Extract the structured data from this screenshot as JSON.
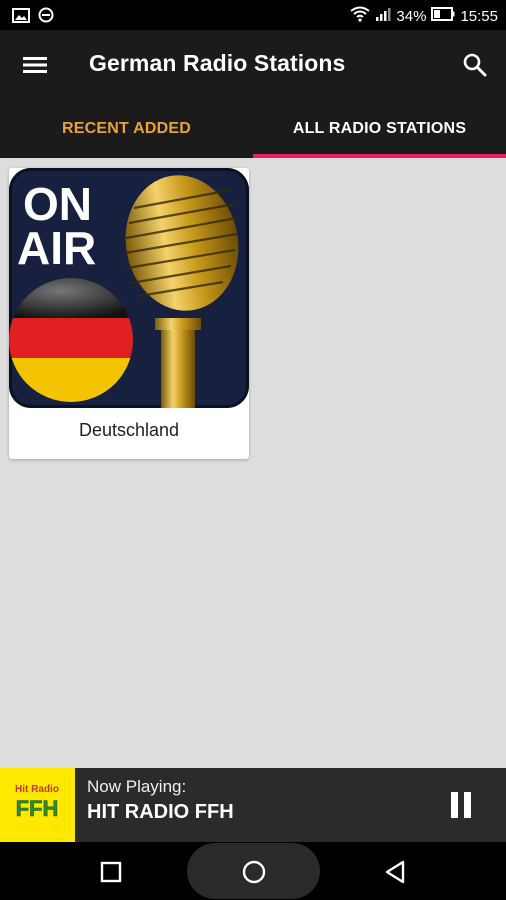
{
  "status_bar": {
    "battery": "34%",
    "time": "15:55",
    "icons": [
      "image-notification-icon",
      "do-not-disturb-icon",
      "wifi-icon",
      "signal-icon",
      "battery-icon"
    ]
  },
  "app_bar": {
    "title": "German Radio Stations",
    "menu_icon": "menu-icon",
    "search_icon": "search-icon"
  },
  "tabs": [
    {
      "label": "RECENT ADDED",
      "selected": false
    },
    {
      "label": "ALL RADIO STATIONS",
      "selected": true
    }
  ],
  "stations": [
    {
      "label": "Deutschland",
      "art": {
        "text_line1": "ON",
        "text_line2": "AIR"
      }
    }
  ],
  "now_playing": {
    "label": "Now Playing:",
    "station": "HIT RADIO FFH",
    "logo": {
      "line1": "Hit Radio",
      "line2": "FFH"
    },
    "control_icon": "pause-icon"
  },
  "nav_bar": {
    "icons": [
      "recents-square-icon",
      "home-circle-icon",
      "back-triangle-icon"
    ]
  },
  "colors": {
    "app_bar_bg": "#1b1b1b",
    "tab_inactive": "#e9a13a",
    "tab_indicator": "#e91e63",
    "content_bg": "#dddddd",
    "ffh_yellow": "#ffe800",
    "ffh_green": "#2e8b2e"
  }
}
